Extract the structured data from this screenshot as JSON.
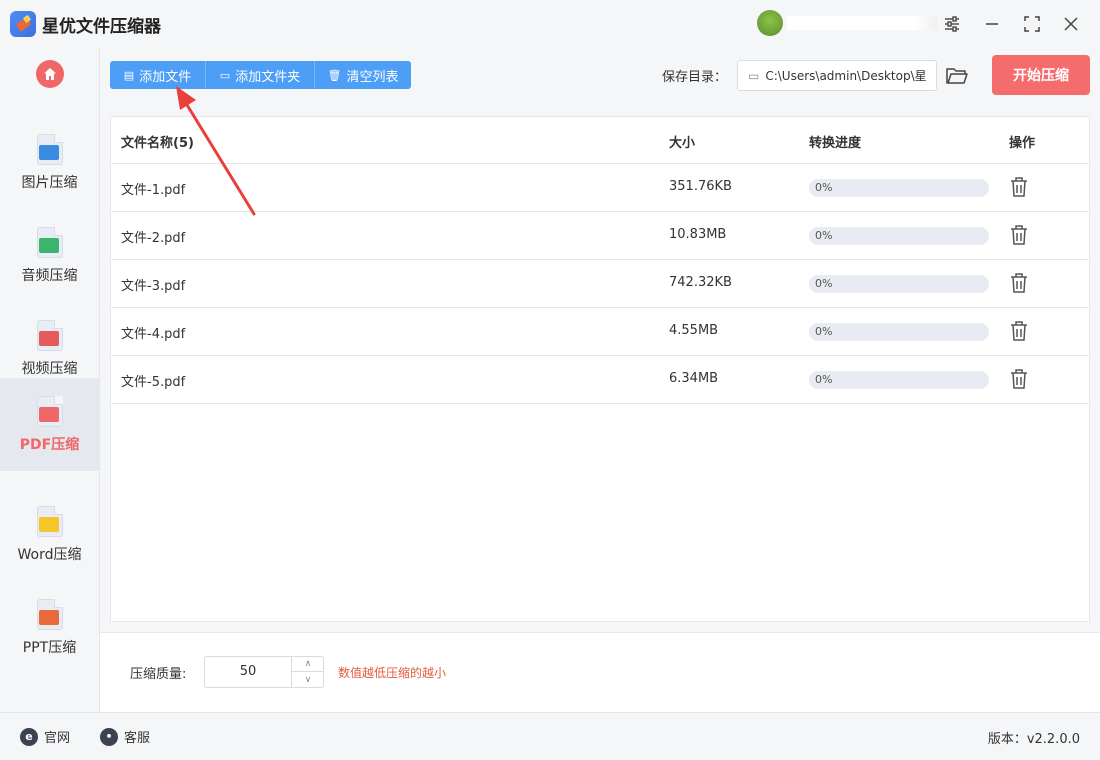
{
  "app": {
    "title": "星优文件压缩器"
  },
  "sidebar": {
    "items": [
      {
        "label": "图片压缩",
        "icon": "image-compress-icon",
        "color": "#3a8be0"
      },
      {
        "label": "音频压缩",
        "icon": "audio-compress-icon",
        "color": "#3bb46d"
      },
      {
        "label": "视频压缩",
        "icon": "video-compress-icon",
        "color": "#e65a5a"
      },
      {
        "label": "PDF压缩",
        "icon": "pdf-compress-icon",
        "color": "#f06767",
        "active": true
      },
      {
        "label": "Word压缩",
        "icon": "word-compress-icon",
        "color": "#f5c52a"
      },
      {
        "label": "PPT压缩",
        "icon": "ppt-compress-icon",
        "color": "#e86a3a"
      }
    ]
  },
  "toolbar": {
    "add_file": "添加文件",
    "add_folder": "添加文件夹",
    "clear_list": "清空列表",
    "save_dir_label": "保存目录：",
    "save_dir_value": "C:\\Users\\admin\\Desktop\\星",
    "start": "开始压缩"
  },
  "table": {
    "headers": {
      "name": "文件名称(5)",
      "size": "大小",
      "progress": "转换进度",
      "action": "操作"
    },
    "rows": [
      {
        "name": "文件-1.pdf",
        "size": "351.76KB",
        "progress": "0%",
        "percent": 0
      },
      {
        "name": "文件-2.pdf",
        "size": "10.83MB",
        "progress": "0%",
        "percent": 0
      },
      {
        "name": "文件-3.pdf",
        "size": "742.32KB",
        "progress": "0%",
        "percent": 0
      },
      {
        "name": "文件-4.pdf",
        "size": "4.55MB",
        "progress": "0%",
        "percent": 0
      },
      {
        "name": "文件-5.pdf",
        "size": "6.34MB",
        "progress": "0%",
        "percent": 0
      }
    ]
  },
  "quality": {
    "label": "压缩质量:",
    "value": "50",
    "hint": "数值越低压缩的越小"
  },
  "footer": {
    "website": "官网",
    "support": "客服",
    "version": "版本：v2.2.0.0"
  },
  "colors": {
    "accent": "#4d9ef7",
    "start": "#f56c6c",
    "active": "#f06767",
    "hint": "#e15b3a",
    "annotation": "#e8403a"
  }
}
